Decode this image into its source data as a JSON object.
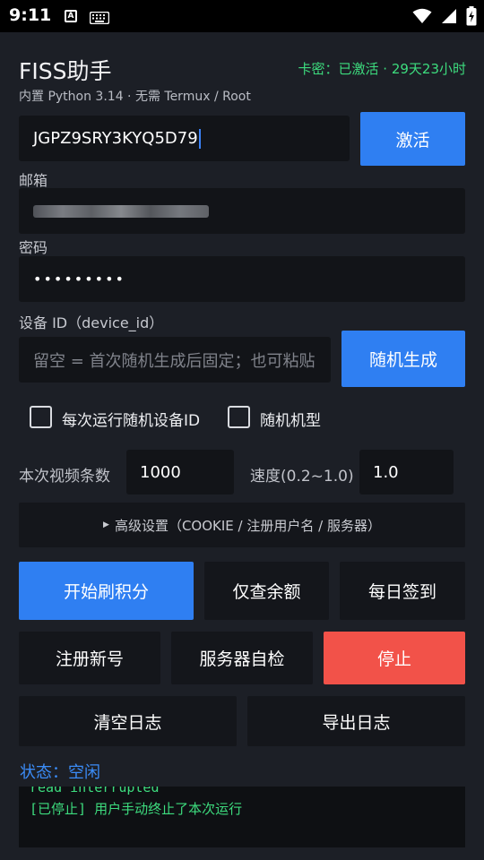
{
  "status_bar": {
    "time": "9:11"
  },
  "app": {
    "title": "FISS助手",
    "subtitle": "内置 Python 3.14 · 无需 Termux / Root",
    "license_status": "卡密：已激活 · 29天23小时"
  },
  "activation": {
    "key_value": "JGPZ9SRY3KYQ5D79",
    "activate_label": "激活"
  },
  "email": {
    "label": "邮箱",
    "value_redacted": "(blurred)"
  },
  "password": {
    "label": "密码",
    "masked_value": "•••••••••"
  },
  "device": {
    "label": "设备 ID（device_id）",
    "placeholder": "留空 = 首次随机生成后固定；也可粘贴",
    "random_label": "随机生成"
  },
  "options": {
    "random_device_each_run": {
      "label": "每次运行随机设备ID",
      "checked": false
    },
    "random_model": {
      "label": "随机机型",
      "checked": false
    }
  },
  "params": {
    "video_count_label": "本次视频条数",
    "video_count_value": "1000",
    "speed_label": "速度(0.2~1.0)",
    "speed_value": "1.0"
  },
  "advanced": {
    "label": "高级设置（COOKIE / 注册用户名 / 服务器）"
  },
  "actions": {
    "start": "开始刷积分",
    "check_balance": "仅查余额",
    "daily_checkin": "每日签到",
    "register": "注册新号",
    "server_check": "服务器自检",
    "stop": "停止",
    "clear_log": "清空日志",
    "export_log": "导出日志"
  },
  "status": {
    "text": "状态：空闲"
  },
  "log": {
    "lines": [
      "read interrupted",
      "[已停止] 用户手动终止了本次运行"
    ]
  },
  "colors": {
    "accent_blue": "#2f7ff2",
    "stop_red": "#f25249",
    "success_green": "#3ddc7e",
    "background": "#1c1f26"
  }
}
